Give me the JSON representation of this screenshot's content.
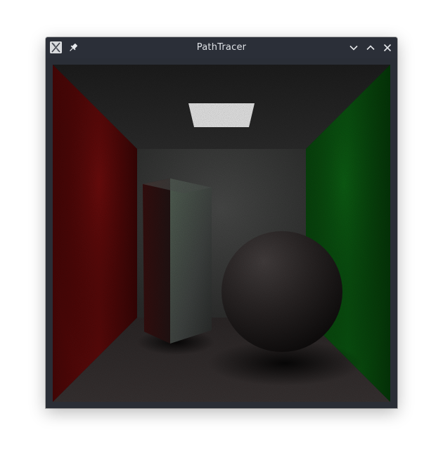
{
  "window": {
    "title": "PathTracer",
    "icons": {
      "app": "pathtracer-app-icon",
      "pin": "pin-icon",
      "minimize": "chevron-down-icon",
      "maximize": "chevron-up-icon",
      "close": "close-icon"
    }
  },
  "scene": {
    "name": "cornell-box",
    "colors": {
      "left_wall": "#6a0c0c",
      "right_wall": "#0b5a12",
      "back_wall": "#4a4a4a",
      "ceiling": "#2a2a2a",
      "floor": "#3a3535",
      "light": "#ffffff"
    }
  }
}
